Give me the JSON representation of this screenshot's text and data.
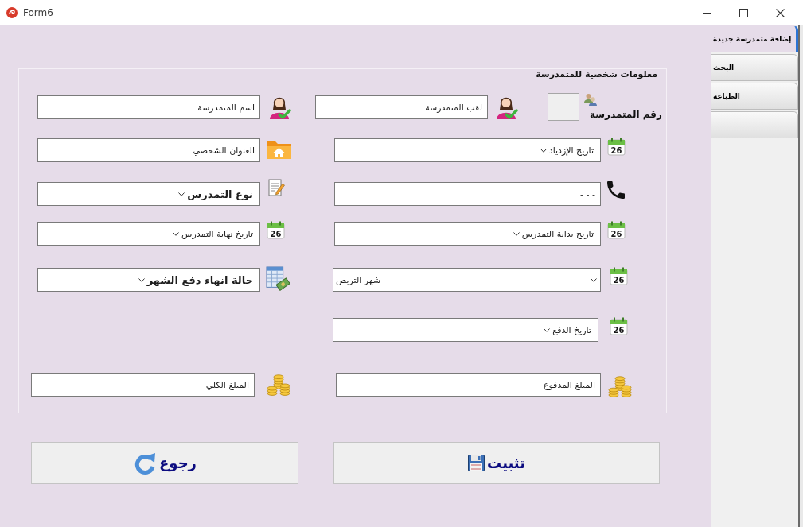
{
  "window": {
    "title": "Form6"
  },
  "tabs": [
    {
      "label": "إضافة متمدرسة جديدة",
      "selected": true
    },
    {
      "label": "البحث",
      "selected": false
    },
    {
      "label": "الطباعة",
      "selected": false
    },
    {
      "selected": false
    }
  ],
  "form": {
    "section_title": "معلومات شخصية للمتمدرسة",
    "student_number": {
      "label": "رقم المتمدرسة",
      "read_only": true
    },
    "fields": [
      {
        "kind": "text",
        "value": "لقب المتمدرسة",
        "emphasized": false
      },
      {
        "kind": "text",
        "value": "اسم المتمدرسة",
        "emphasized": false
      },
      {
        "kind": "picker",
        "value": "تاريخ الإزدياد",
        "emphasized": false,
        "icon_text": "26"
      },
      {
        "kind": "text",
        "value": "العنوان الشخصي",
        "emphasized": false
      },
      {
        "kind": "text",
        "value": "- - -",
        "emphasized": false
      },
      {
        "kind": "picker",
        "value": "نوع التمدرس",
        "emphasized": true
      },
      {
        "kind": "picker",
        "value": "تاريخ بداية التمدرس",
        "emphasized": false,
        "icon_text": "26"
      },
      {
        "kind": "picker",
        "value": "تاريخ نهاية التمدرس",
        "emphasized": false,
        "icon_text": "26"
      },
      {
        "kind": "combo",
        "value": "شهر التربص",
        "emphasized": false,
        "icon_text": "26"
      },
      {
        "kind": "picker",
        "value": "حالة انهاء دفع الشهر",
        "emphasized": true
      },
      {
        "kind": "picker",
        "value": "تاريخ الدفع",
        "emphasized": false,
        "icon_text": "26"
      },
      {
        "kind": "text",
        "value": "المبلغ المدفوع",
        "emphasized": false
      },
      {
        "kind": "text",
        "value": "المبلغ الكلي",
        "emphasized": false
      }
    ]
  },
  "buttons": [
    {
      "kind": "save",
      "label": "تثبيت"
    },
    {
      "kind": "back",
      "label": "رجوع"
    }
  ]
}
